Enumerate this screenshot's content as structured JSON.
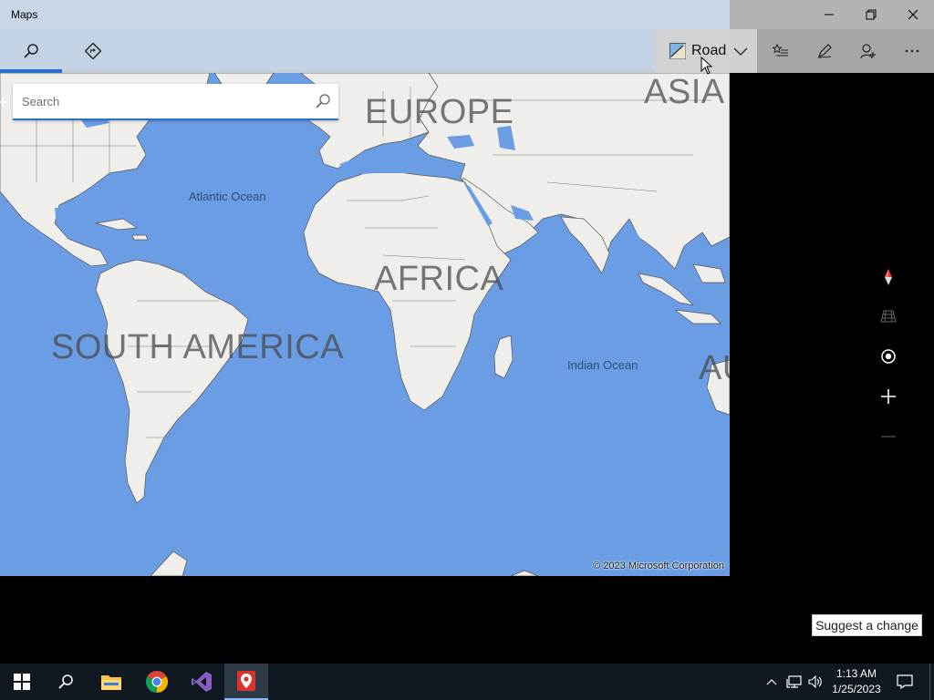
{
  "window": {
    "title": "Maps"
  },
  "toolbar": {
    "map_style_label": "Road",
    "items": [
      {
        "icon": "search-icon"
      },
      {
        "icon": "directions-icon"
      },
      {
        "icon": "favorites-icon"
      },
      {
        "icon": "ink-pen-icon"
      },
      {
        "icon": "add-person-icon"
      },
      {
        "icon": "more-icon"
      }
    ]
  },
  "search": {
    "placeholder": "Search"
  },
  "map": {
    "continents": [
      "EUROPE",
      "ASIA",
      "AFRICA",
      "SOUTH AMERICA",
      "AU"
    ],
    "oceans": [
      "Atlantic Ocean",
      "Indian Ocean"
    ],
    "copyright": "© 2023 Microsoft Corporation",
    "water_color": "#6a9de3",
    "land_color": "#efeeea"
  },
  "map_controls": [
    "compass-icon",
    "tilt-icon",
    "locate-icon",
    "zoom-in-icon",
    "zoom-out-icon"
  ],
  "suggest_change_label": "Suggest a change",
  "taskbar": {
    "apps": [
      "start-icon",
      "search-icon",
      "file-explorer-icon",
      "chrome-icon",
      "visual-studio-icon",
      "maps-app-icon"
    ],
    "clock_time": "1:13 AM",
    "clock_date": "1/25/2023"
  }
}
